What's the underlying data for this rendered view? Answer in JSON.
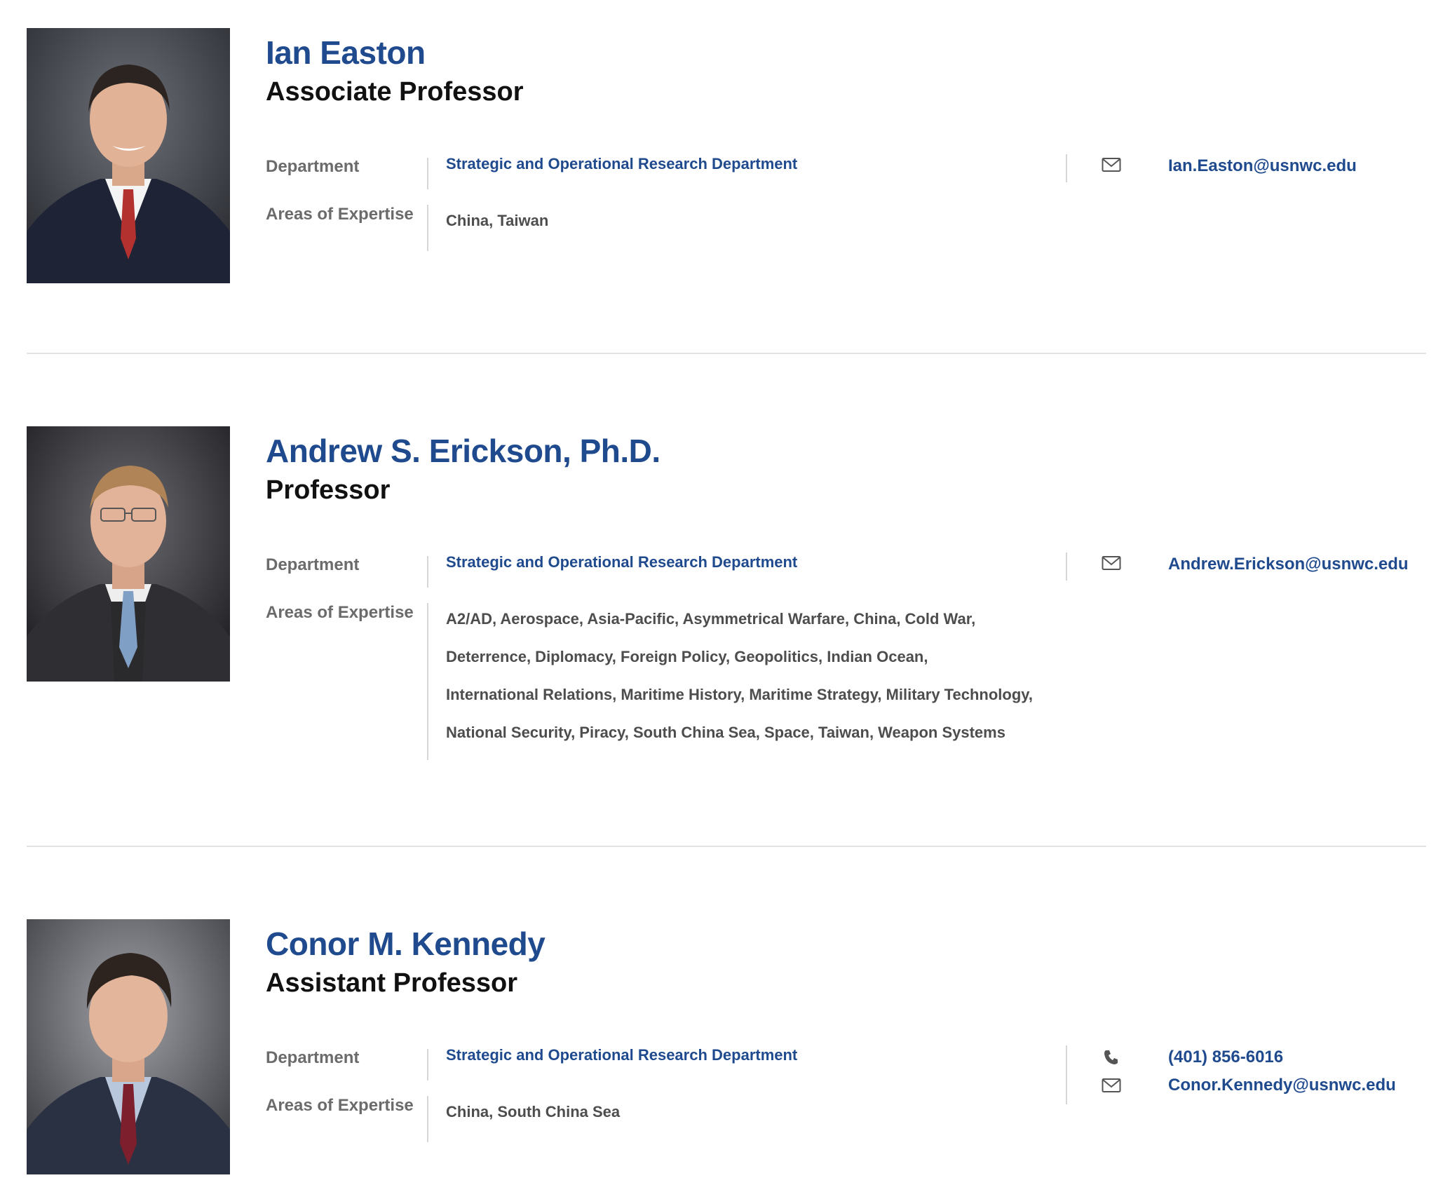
{
  "labels": {
    "department": "Department",
    "areas": "Areas of Expertise"
  },
  "people": [
    {
      "name": "Ian Easton",
      "title": "Associate Professor",
      "department": "Strategic and Operational Research Department",
      "expertise_lines": [
        "China, Taiwan"
      ],
      "phone": null,
      "email": "Ian.Easton@usnwc.edu"
    },
    {
      "name": "Andrew S. Erickson, Ph.D.",
      "title": "Professor",
      "department": "Strategic and Operational Research Department",
      "expertise_lines": [
        "A2/AD, Aerospace, Asia-Pacific, Asymmetrical Warfare, China, Cold War,",
        "Deterrence, Diplomacy, Foreign Policy, Geopolitics, Indian Ocean,",
        "International Relations, Maritime History, Maritime Strategy, Military Technology,",
        "National Security, Piracy, South China Sea, Space, Taiwan, Weapon Systems"
      ],
      "phone": null,
      "email": "Andrew.Erickson@usnwc.edu"
    },
    {
      "name": "Conor M. Kennedy",
      "title": "Assistant Professor",
      "department": "Strategic and Operational Research Department",
      "expertise_lines": [
        "China, South China Sea"
      ],
      "phone": "(401) 856-6016",
      "email": "Conor.Kennedy@usnwc.edu"
    }
  ],
  "colors": {
    "accent": "#1f4a8e",
    "title": "#111111",
    "label": "#6b6b6b",
    "body": "#4d4d4d",
    "rule": "#d6d6d6"
  }
}
